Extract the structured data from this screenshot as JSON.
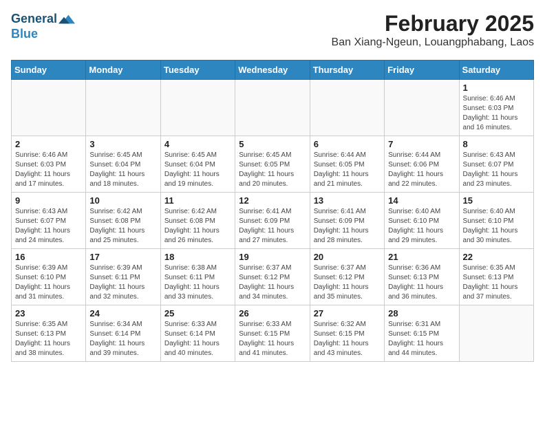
{
  "logo": {
    "line1": "General",
    "line2": "Blue"
  },
  "title": "February 2025",
  "subtitle": "Ban Xiang-Ngeun, Louangphabang, Laos",
  "weekdays": [
    "Sunday",
    "Monday",
    "Tuesday",
    "Wednesday",
    "Thursday",
    "Friday",
    "Saturday"
  ],
  "weeks": [
    [
      {
        "day": "",
        "info": ""
      },
      {
        "day": "",
        "info": ""
      },
      {
        "day": "",
        "info": ""
      },
      {
        "day": "",
        "info": ""
      },
      {
        "day": "",
        "info": ""
      },
      {
        "day": "",
        "info": ""
      },
      {
        "day": "1",
        "info": "Sunrise: 6:46 AM\nSunset: 6:03 PM\nDaylight: 11 hours\nand 16 minutes."
      }
    ],
    [
      {
        "day": "2",
        "info": "Sunrise: 6:46 AM\nSunset: 6:03 PM\nDaylight: 11 hours\nand 17 minutes."
      },
      {
        "day": "3",
        "info": "Sunrise: 6:45 AM\nSunset: 6:04 PM\nDaylight: 11 hours\nand 18 minutes."
      },
      {
        "day": "4",
        "info": "Sunrise: 6:45 AM\nSunset: 6:04 PM\nDaylight: 11 hours\nand 19 minutes."
      },
      {
        "day": "5",
        "info": "Sunrise: 6:45 AM\nSunset: 6:05 PM\nDaylight: 11 hours\nand 20 minutes."
      },
      {
        "day": "6",
        "info": "Sunrise: 6:44 AM\nSunset: 6:05 PM\nDaylight: 11 hours\nand 21 minutes."
      },
      {
        "day": "7",
        "info": "Sunrise: 6:44 AM\nSunset: 6:06 PM\nDaylight: 11 hours\nand 22 minutes."
      },
      {
        "day": "8",
        "info": "Sunrise: 6:43 AM\nSunset: 6:07 PM\nDaylight: 11 hours\nand 23 minutes."
      }
    ],
    [
      {
        "day": "9",
        "info": "Sunrise: 6:43 AM\nSunset: 6:07 PM\nDaylight: 11 hours\nand 24 minutes."
      },
      {
        "day": "10",
        "info": "Sunrise: 6:42 AM\nSunset: 6:08 PM\nDaylight: 11 hours\nand 25 minutes."
      },
      {
        "day": "11",
        "info": "Sunrise: 6:42 AM\nSunset: 6:08 PM\nDaylight: 11 hours\nand 26 minutes."
      },
      {
        "day": "12",
        "info": "Sunrise: 6:41 AM\nSunset: 6:09 PM\nDaylight: 11 hours\nand 27 minutes."
      },
      {
        "day": "13",
        "info": "Sunrise: 6:41 AM\nSunset: 6:09 PM\nDaylight: 11 hours\nand 28 minutes."
      },
      {
        "day": "14",
        "info": "Sunrise: 6:40 AM\nSunset: 6:10 PM\nDaylight: 11 hours\nand 29 minutes."
      },
      {
        "day": "15",
        "info": "Sunrise: 6:40 AM\nSunset: 6:10 PM\nDaylight: 11 hours\nand 30 minutes."
      }
    ],
    [
      {
        "day": "16",
        "info": "Sunrise: 6:39 AM\nSunset: 6:10 PM\nDaylight: 11 hours\nand 31 minutes."
      },
      {
        "day": "17",
        "info": "Sunrise: 6:39 AM\nSunset: 6:11 PM\nDaylight: 11 hours\nand 32 minutes."
      },
      {
        "day": "18",
        "info": "Sunrise: 6:38 AM\nSunset: 6:11 PM\nDaylight: 11 hours\nand 33 minutes."
      },
      {
        "day": "19",
        "info": "Sunrise: 6:37 AM\nSunset: 6:12 PM\nDaylight: 11 hours\nand 34 minutes."
      },
      {
        "day": "20",
        "info": "Sunrise: 6:37 AM\nSunset: 6:12 PM\nDaylight: 11 hours\nand 35 minutes."
      },
      {
        "day": "21",
        "info": "Sunrise: 6:36 AM\nSunset: 6:13 PM\nDaylight: 11 hours\nand 36 minutes."
      },
      {
        "day": "22",
        "info": "Sunrise: 6:35 AM\nSunset: 6:13 PM\nDaylight: 11 hours\nand 37 minutes."
      }
    ],
    [
      {
        "day": "23",
        "info": "Sunrise: 6:35 AM\nSunset: 6:13 PM\nDaylight: 11 hours\nand 38 minutes."
      },
      {
        "day": "24",
        "info": "Sunrise: 6:34 AM\nSunset: 6:14 PM\nDaylight: 11 hours\nand 39 minutes."
      },
      {
        "day": "25",
        "info": "Sunrise: 6:33 AM\nSunset: 6:14 PM\nDaylight: 11 hours\nand 40 minutes."
      },
      {
        "day": "26",
        "info": "Sunrise: 6:33 AM\nSunset: 6:15 PM\nDaylight: 11 hours\nand 41 minutes."
      },
      {
        "day": "27",
        "info": "Sunrise: 6:32 AM\nSunset: 6:15 PM\nDaylight: 11 hours\nand 43 minutes."
      },
      {
        "day": "28",
        "info": "Sunrise: 6:31 AM\nSunset: 6:15 PM\nDaylight: 11 hours\nand 44 minutes."
      },
      {
        "day": "",
        "info": ""
      }
    ]
  ]
}
